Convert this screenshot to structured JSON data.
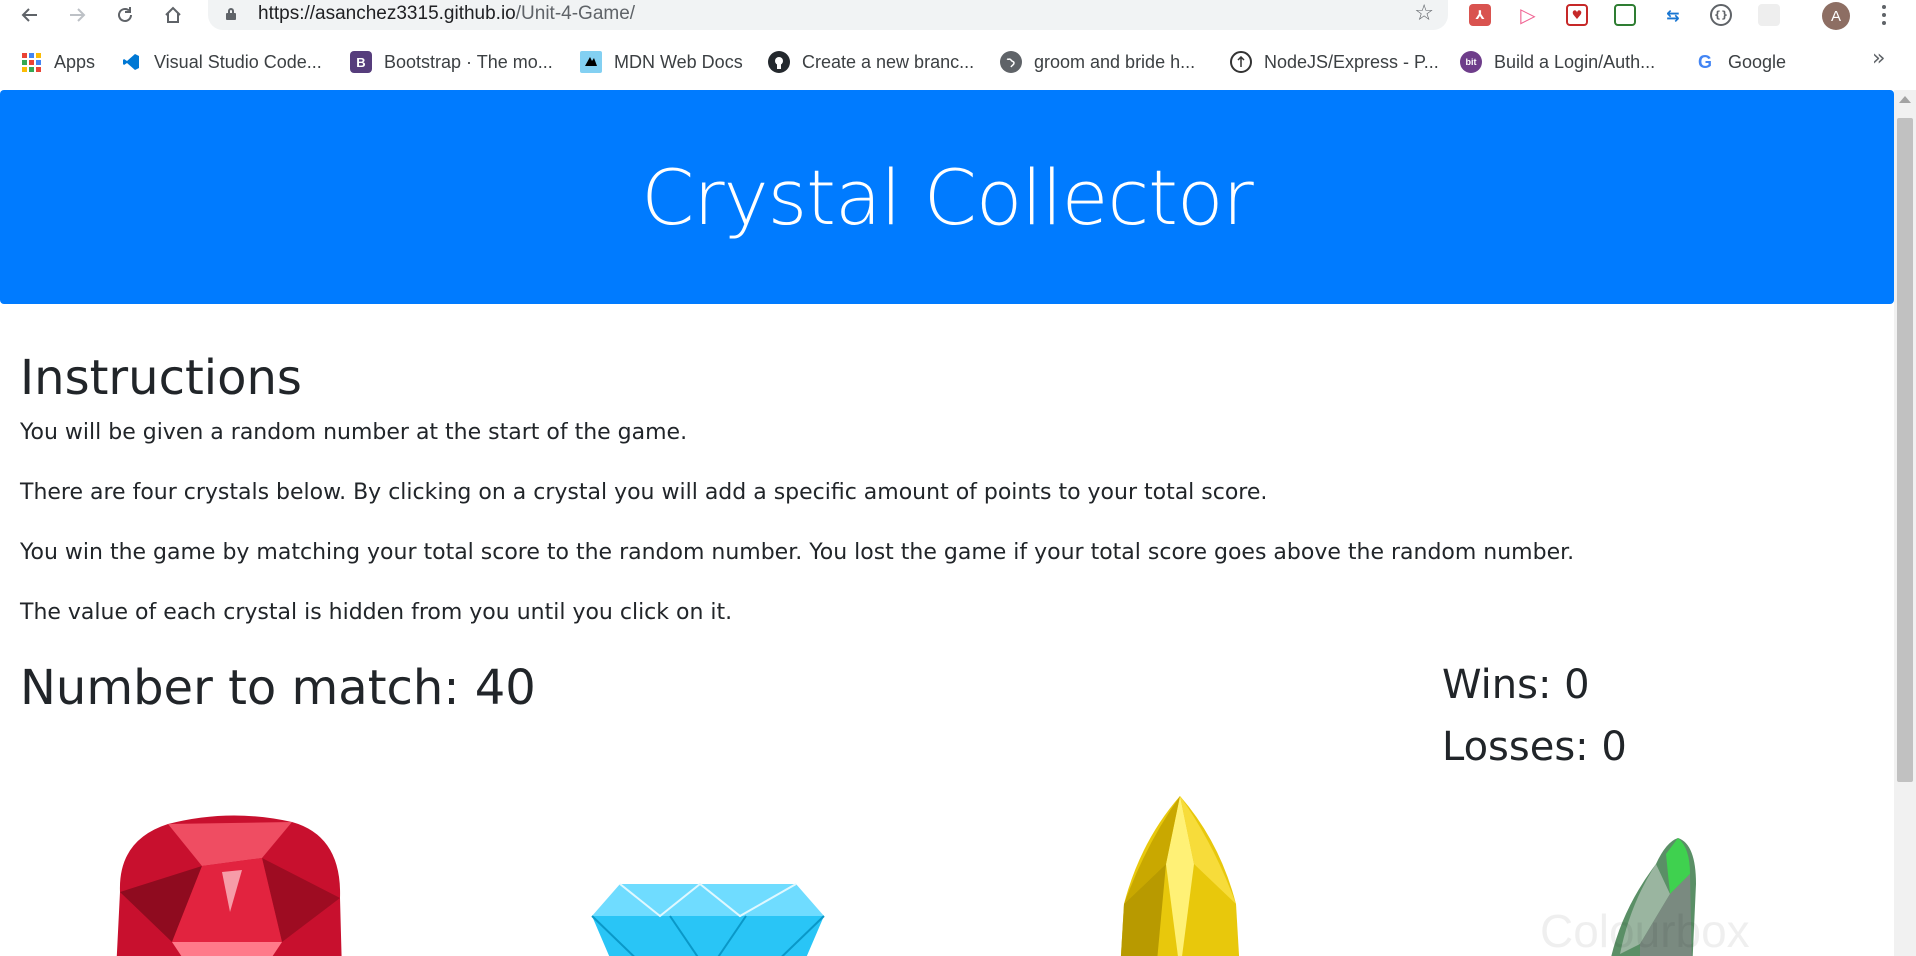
{
  "browser": {
    "url_host": "https://asanchez3315.github.io",
    "url_path": "/Unit-4-Game/",
    "profile_initial": "A",
    "bookmarks": [
      {
        "label": "Apps",
        "icon": "apps-grid-icon"
      },
      {
        "label": "Visual Studio Code...",
        "icon": "vscode-icon"
      },
      {
        "label": "Bootstrap · The mo...",
        "icon": "bootstrap-icon",
        "glyph": "B"
      },
      {
        "label": "MDN Web Docs",
        "icon": "mdn-icon"
      },
      {
        "label": "Create a new branc...",
        "icon": "github-icon"
      },
      {
        "label": "groom and bride h...",
        "icon": "globe-icon"
      },
      {
        "label": "NodeJS/Express - P...",
        "icon": "nodejs-icon"
      },
      {
        "label": "Build a Login/Auth...",
        "icon": "bit-icon",
        "glyph": "bit"
      },
      {
        "label": "Google",
        "icon": "google-icon",
        "glyph": "G"
      }
    ]
  },
  "header": {
    "title": "Crystal Collector"
  },
  "instructions": {
    "title": "Instructions",
    "paragraphs": [
      "You will be given a random number at the start of the game.",
      "There are four crystals below. By clicking on a crystal you will add a specific amount of points to your total score.",
      "You win the game by matching your total score to the random number. You lost the game if your total score goes above the random number.",
      "The value of each crystal is hidden from you until you click on it."
    ]
  },
  "game": {
    "number_to_match": "Number to match: 40",
    "wins": "Wins: 0",
    "losses": "Losses: 0",
    "crystals": [
      {
        "name": "red-crystal",
        "color": "#c8102e"
      },
      {
        "name": "blue-crystal",
        "color": "#29c5f6"
      },
      {
        "name": "yellow-crystal",
        "color": "#e8c80c"
      },
      {
        "name": "green-crystal",
        "color": "#3fa34d"
      }
    ],
    "watermark": "Colourbox"
  }
}
